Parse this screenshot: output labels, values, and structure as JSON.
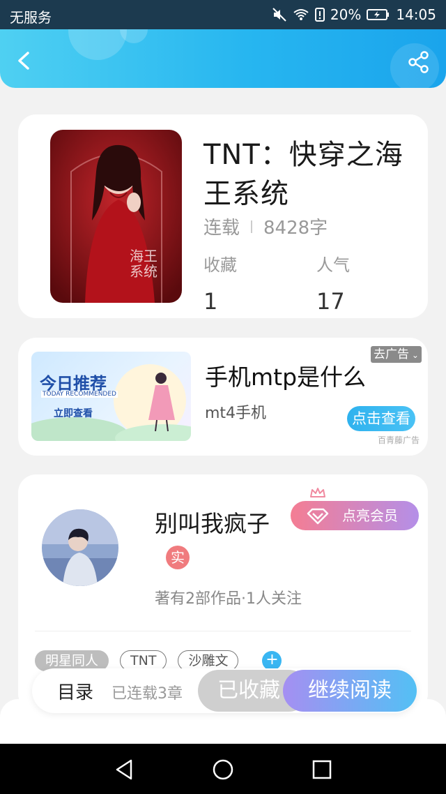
{
  "status_bar": {
    "carrier": "无服务",
    "battery": "20%",
    "time": "14:05"
  },
  "header": {
    "back_icon": "chevron-left-icon",
    "share_icon": "share-icon"
  },
  "book": {
    "title": "TNT：快穿之海王系统",
    "status": "连载",
    "word_count": "8428字",
    "favorites_label": "收藏",
    "favorites_value": "1",
    "popularity_label": "人气",
    "popularity_value": "17",
    "cover_text": "海王系统"
  },
  "ad": {
    "banner_title": "今日推荐",
    "banner_subtitle": "TODAY RECOMMENDED",
    "banner_cta": "立即查看",
    "title": "手机mtp是什么",
    "subtitle": "mt4手机",
    "close_label": "去广告",
    "cta_label": "点击查看",
    "source": "百青藤广告"
  },
  "author": {
    "name": "别叫我疯子",
    "verified_badge": "实",
    "vip_button": "点亮会员",
    "stats": "著有2部作品·1人关注",
    "tags": [
      "明星同人",
      "TNT",
      "沙雕文"
    ],
    "add_tag_icon": "plus-icon"
  },
  "action_bar": {
    "toc_label": "目录",
    "chapter_count": "已连载3章",
    "saved_label": "已收藏",
    "read_label": "继续阅读"
  },
  "colors": {
    "header_start": "#4fd0f2",
    "header_end": "#1aa4ec",
    "accent_blue": "#2fb2ee",
    "vip_pink": "#f47d93",
    "vip_purple": "#b48fe8",
    "badge_red": "#f07b7e"
  }
}
